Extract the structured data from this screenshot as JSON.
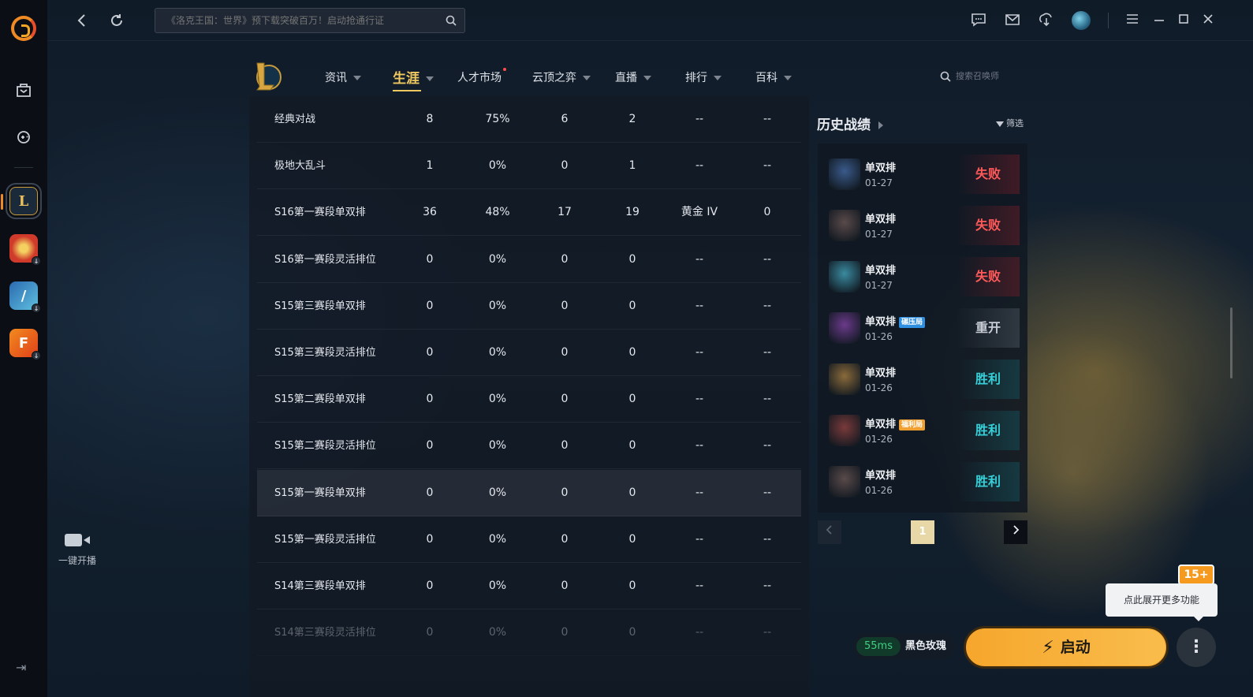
{
  "topbar": {
    "search_placeholder": "《洛克王国：世界》预下载突破百万！启动抢通行证",
    "icons": [
      "back-icon",
      "refresh-icon",
      "search-icon",
      "chat-icon",
      "mail-icon",
      "download-icon",
      "menu-icon",
      "minimize-icon",
      "maximize-icon",
      "close-icon"
    ]
  },
  "rail": {
    "live_label": "一键开播",
    "games": [
      "lol",
      "gamepad-red",
      "shooter-blue",
      "f-orange"
    ]
  },
  "nav": {
    "items": [
      {
        "label": "资讯"
      },
      {
        "label": "生涯"
      },
      {
        "label": "人才市场"
      },
      {
        "label": "云顶之弈"
      },
      {
        "label": "直播"
      },
      {
        "label": "排行"
      },
      {
        "label": "百科"
      }
    ],
    "search_placeholder": "搜索召唤师"
  },
  "stats": {
    "rows": [
      {
        "mode": "经典对战",
        "games": "8",
        "winrate": "75%",
        "wins": "6",
        "losses": "2",
        "rank": "--",
        "points": "--"
      },
      {
        "mode": "极地大乱斗",
        "games": "1",
        "winrate": "0%",
        "wins": "0",
        "losses": "1",
        "rank": "--",
        "points": "--"
      },
      {
        "mode": "S16第一赛段单双排",
        "games": "36",
        "winrate": "48%",
        "wins": "17",
        "losses": "19",
        "rank": "黄金 IV",
        "points": "0"
      },
      {
        "mode": "S16第一赛段灵活排位",
        "games": "0",
        "winrate": "0%",
        "wins": "0",
        "losses": "0",
        "rank": "--",
        "points": "--"
      },
      {
        "mode": "S15第三赛段单双排",
        "games": "0",
        "winrate": "0%",
        "wins": "0",
        "losses": "0",
        "rank": "--",
        "points": "--"
      },
      {
        "mode": "S15第三赛段灵活排位",
        "games": "0",
        "winrate": "0%",
        "wins": "0",
        "losses": "0",
        "rank": "--",
        "points": "--"
      },
      {
        "mode": "S15第二赛段单双排",
        "games": "0",
        "winrate": "0%",
        "wins": "0",
        "losses": "0",
        "rank": "--",
        "points": "--"
      },
      {
        "mode": "S15第二赛段灵活排位",
        "games": "0",
        "winrate": "0%",
        "wins": "0",
        "losses": "0",
        "rank": "--",
        "points": "--"
      },
      {
        "mode": "S15第一赛段单双排",
        "games": "0",
        "winrate": "0%",
        "wins": "0",
        "losses": "0",
        "rank": "--",
        "points": "--"
      },
      {
        "mode": "S15第一赛段灵活排位",
        "games": "0",
        "winrate": "0%",
        "wins": "0",
        "losses": "0",
        "rank": "--",
        "points": "--"
      },
      {
        "mode": "S14第三赛段单双排",
        "games": "0",
        "winrate": "0%",
        "wins": "0",
        "losses": "0",
        "rank": "--",
        "points": "--"
      },
      {
        "mode": "S14第三赛段灵活排位",
        "games": "0",
        "winrate": "0%",
        "wins": "0",
        "losses": "0",
        "rank": "--",
        "points": "--"
      }
    ]
  },
  "history": {
    "title": "历史战绩",
    "filter_label": "筛选",
    "matches": [
      {
        "mode": "单双排",
        "date": "01-27",
        "result": "失败",
        "outcome": "lose",
        "tag": "",
        "champ_color": "#3a5a8a"
      },
      {
        "mode": "单双排",
        "date": "01-27",
        "result": "失败",
        "outcome": "lose",
        "tag": "",
        "champ_color": "#5a4a4a"
      },
      {
        "mode": "单双排",
        "date": "01-27",
        "result": "失败",
        "outcome": "lose",
        "tag": "",
        "champ_color": "#3a8aa0"
      },
      {
        "mode": "单双排",
        "date": "01-26",
        "result": "重开",
        "outcome": "remake",
        "tag": "碾压局",
        "tag_color": "#2f8fe0",
        "champ_color": "#6a3a8a"
      },
      {
        "mode": "单双排",
        "date": "01-26",
        "result": "胜利",
        "outcome": "win",
        "tag": "",
        "champ_color": "#8a6a3a"
      },
      {
        "mode": "单双排",
        "date": "01-26",
        "result": "胜利",
        "outcome": "win",
        "tag": "福利局",
        "tag_color": "#f0a030",
        "champ_color": "#7a3a3a"
      },
      {
        "mode": "单双排",
        "date": "01-26",
        "result": "胜利",
        "outcome": "win",
        "tag": "",
        "champ_color": "#5a4a4a"
      }
    ],
    "page": "1"
  },
  "launcher": {
    "latency": "55ms",
    "server": "黑色玫瑰",
    "launch_label": "启动",
    "tooltip": "点此展开更多功能",
    "age_badge": "15+"
  },
  "colors": {
    "accent": "#f0c860",
    "launch": "#f6a62c",
    "lose": "#ff5a5a",
    "win": "#36d0d8"
  }
}
